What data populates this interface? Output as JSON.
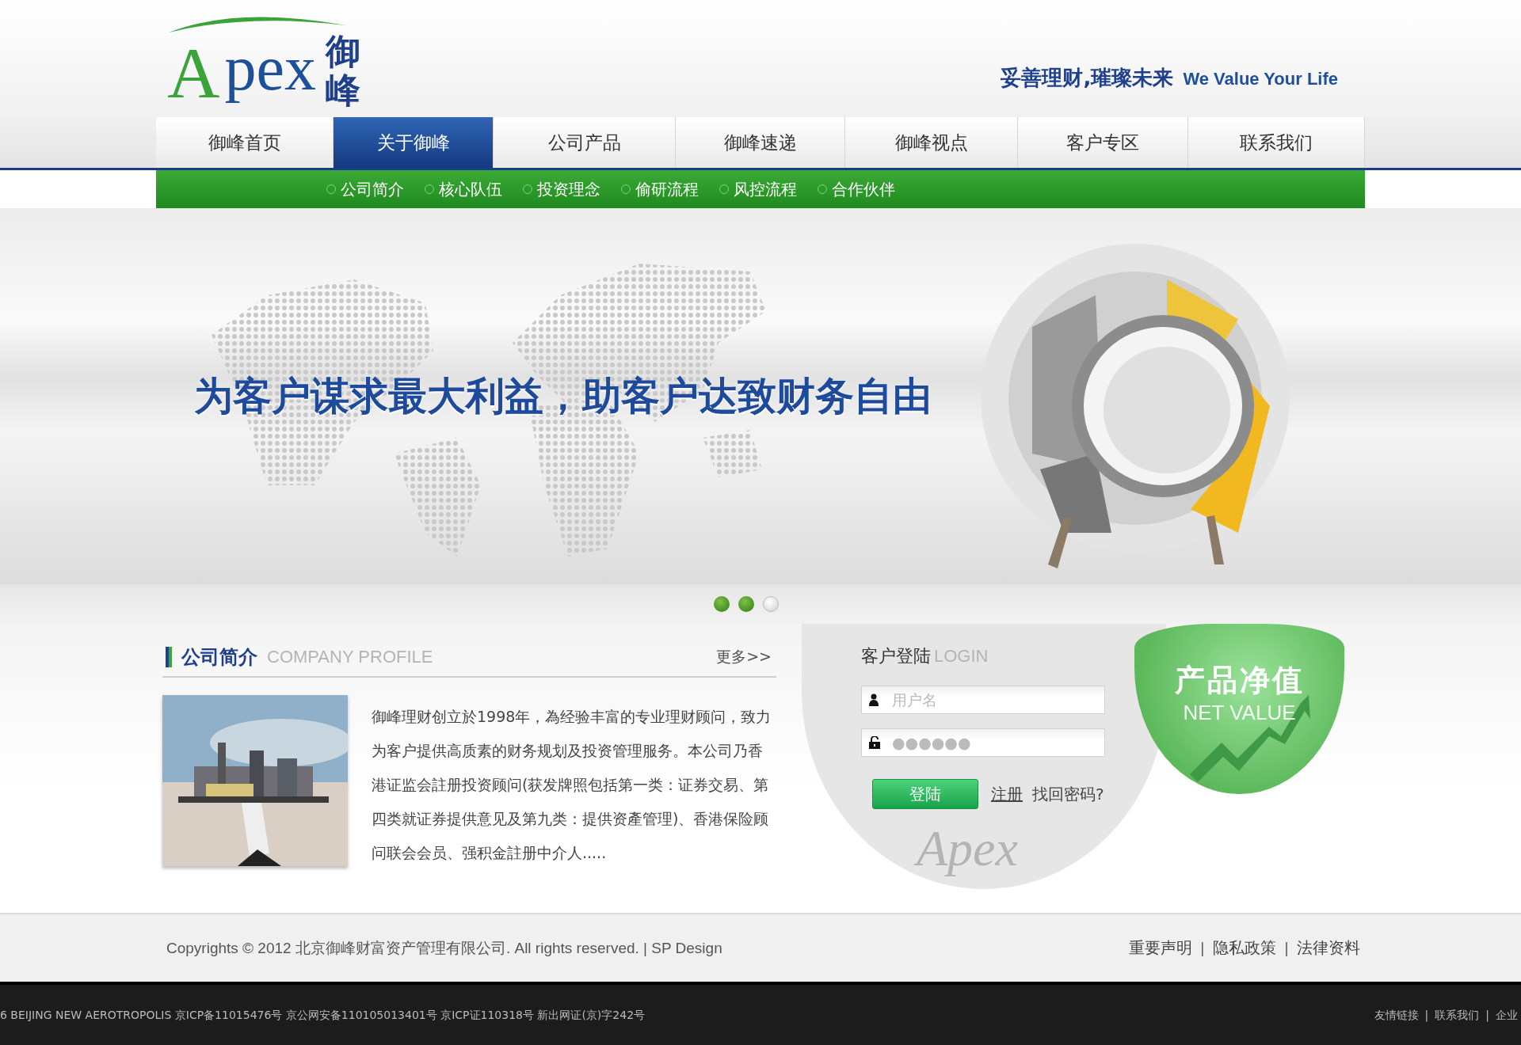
{
  "logo": {
    "letter": "A",
    "rest": "pex",
    "chinese": "御峰"
  },
  "tagline": {
    "chinese": "妥善理财,璀璨未来",
    "english": "We Value Your Life"
  },
  "nav": [
    {
      "label": "御峰首页",
      "selected": false
    },
    {
      "label": "关于御峰",
      "selected": true
    },
    {
      "label": "公司产品",
      "selected": false
    },
    {
      "label": "御峰速递",
      "selected": false
    },
    {
      "label": "御峰视点",
      "selected": false
    },
    {
      "label": "客户专区",
      "selected": false
    },
    {
      "label": "联系我们",
      "selected": false
    }
  ],
  "subnav": [
    "公司简介",
    "核心队伍",
    "投资理念",
    "偷研流程",
    "风控流程",
    "合作伙伴"
  ],
  "banner": {
    "slogan": "为客户谋求最大利益，助客户达致财务自由"
  },
  "slider_dots": [
    {
      "selected": false
    },
    {
      "selected": false
    },
    {
      "selected": true
    }
  ],
  "profile": {
    "title": "公司简介",
    "subtitle": "COMPANY PROFILE",
    "more": "更多>>",
    "text": "御峰理财创立於1998年，為经验丰富的专业理财顾问，致力为客户提供高质素的财务规划及投资管理服务。本公司乃香港证监会註册投资顾问(获发牌照包括第一类：证券交易、第四类就证券提供意见及第九类：提供资產管理)、香港保险顾问联会会员、强积金註册中介人....."
  },
  "login": {
    "title": "客户登陆",
    "subtitle": "LOGIN",
    "username": {
      "placeholder": "用户名"
    },
    "password": {
      "placeholder": "●●●●●●"
    },
    "button": "登陆",
    "register": "注册",
    "forgot": "找回密码?",
    "watermark": "Apex"
  },
  "net_value": {
    "title": "产品净值",
    "subtitle": "NET VALUE"
  },
  "footer": {
    "copyright": "Copyrights © 2012 北京御峰财富资产管理有限公司. All rights reserved. | SP Design",
    "links": [
      "重要声明",
      "隐私政策",
      "法律资料"
    ],
    "separator": "|"
  },
  "bottom_bar": {
    "text": "6 BEIJING NEW AEROTROPOLIS 京ICP备11015476号 京公网安备110105013401号 京ICP证110318号 新出网证(京)字242号",
    "links": [
      "友情链接",
      "联系我们",
      "企业"
    ],
    "separator": "|"
  }
}
